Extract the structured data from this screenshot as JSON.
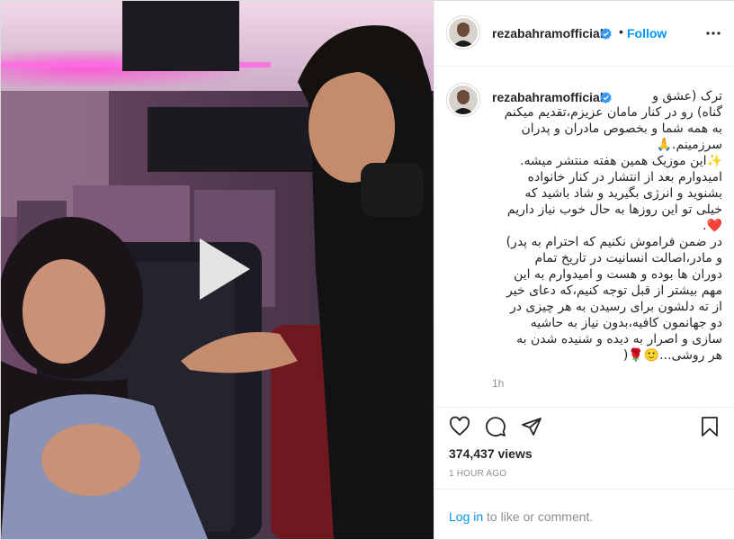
{
  "post": {
    "username": "rezabahramofficial",
    "follow_label": "Follow",
    "dot": "•",
    "caption_lines": [
      "ترک (عشق و",
      "گناه) رو در کنار مامان عزیزم،تقدیم میکنم",
      "به همه شما و بخصوص مادران و پدران",
      "سرزمینم.🙏",
      "✨این موزیک همین هفته منتشر میشه.",
      "امیدوارم بعد از انتشار در کنار خانواده",
      "بشنوید و انرژی بگیرید و شاد باشید که",
      "خیلی تو این روزها به حال خوب نیاز داریم",
      "❤️.",
      "در ضمن فراموش نکنیم که احترام به پدر)",
      "و مادر،اصالت انسانیت در تاریخ تمام",
      "دوران ها بوده و هست و امیدوارم به این",
      "مهم بیشتر از قبل توجه کنیم،که دعای خیر",
      "از ته دلشون برای رسیدن به هر چیزی در",
      "دو جهانمون کافیه،بدون نیاز به حاشیه",
      "سازی و اصرار به دیده و شنیده شدن به",
      "هر روشی...🙂🌹("
    ],
    "caption_time": "1h",
    "views": "374,437 views",
    "posted_time": "1 HOUR AGO"
  },
  "footer": {
    "login_label": "Log in",
    "rest": " to like or comment."
  },
  "icons": {
    "verified": "verified-badge-icon",
    "more": "more-options-icon",
    "like": "heart-icon",
    "comment": "comment-icon",
    "share": "share-icon",
    "save": "bookmark-icon",
    "play": "play-icon"
  },
  "colors": {
    "accent": "#0095f6",
    "verified": "#3897f0",
    "muted": "#8e8e8e",
    "text": "#262626"
  }
}
